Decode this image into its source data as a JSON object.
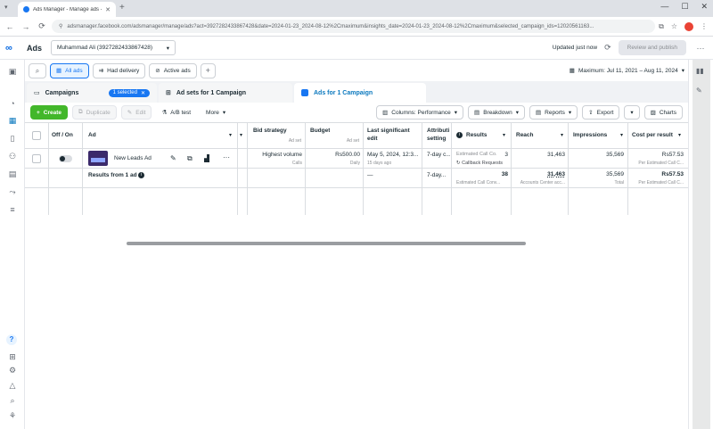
{
  "browser": {
    "tab_title": "Ads Manager - Manage ads - A...",
    "url": "adsmanager.facebook.com/adsmanager/manage/ads?act=3927282433867428&date=2024-01-23_2024-08-12%2Cmaximum&insights_date=2024-01-23_2024-08-12%2Cmaximum&selected_campaign_ids=12020561163...",
    "nav": {
      "back": "←",
      "forward": "→",
      "reload": "C"
    },
    "window_controls": {
      "minimize": "—",
      "maximize": "☐",
      "close": "✕"
    }
  },
  "header": {
    "app_title": "Ads",
    "account_name": "Muhammad Ali (3927282433867428)",
    "updated_text": "Updated just now",
    "review_button": "Review and publish"
  },
  "filters": {
    "all_ads": "All ads",
    "had_delivery": "Had delivery",
    "active_ads": "Active ads",
    "date_range": "Maximum: Jul 11, 2021 – Aug 11, 2024"
  },
  "tabs": {
    "campaigns": "Campaigns",
    "selected_badge": "1 selected",
    "adsets": "Ad sets for 1 Campaign",
    "ads": "Ads for 1 Campaign"
  },
  "toolbar": {
    "create": "Create",
    "duplicate": "Duplicate",
    "edit": "Edit",
    "ab_test": "A/B test",
    "more": "More",
    "columns": "Columns: Performance",
    "breakdown": "Breakdown",
    "reports": "Reports",
    "export": "Export",
    "charts": "Charts"
  },
  "table": {
    "headers": {
      "off_on": "Off / On",
      "ad": "Ad",
      "bid_strategy": "Bid strategy",
      "bid_strategy_sub": "Ad set",
      "budget": "Budget",
      "budget_sub": "Ad set",
      "last_edit_1": "Last significant",
      "last_edit_2": "edit",
      "attribution_1": "Attributi",
      "attribution_2": "setting",
      "results": "Results",
      "reach": "Reach",
      "impressions": "Impressions",
      "cost_per_result": "Cost per result"
    },
    "row": {
      "ad_name": "New Leads Ad",
      "bid_strategy": "Highest volume",
      "bid_strategy_sub": "Calls",
      "budget": "Rs500.00",
      "budget_sub": "Daily",
      "last_edit": "May 5, 2024, 12:3...",
      "last_edit_sub": "15 days ago",
      "attribution": "7-day c...",
      "results_label": "Estimated Call Co...",
      "results_value": "3",
      "results_sub": "Callback Requests",
      "reach": "31,463",
      "impressions": "35,569",
      "cost": "Rs57.53",
      "cost_sub": "Per Estimated Call C..."
    },
    "total": {
      "label": "Results from 1 ad",
      "last_edit": "—",
      "attribution": "7-day...",
      "results_value": "38",
      "results_sub": "Estimated Call Conv...",
      "reach": "31,463",
      "reach_sub": "Accounts Center acc...",
      "impressions": "35,569",
      "impressions_sub": "Total",
      "cost": "Rs57.53",
      "cost_sub": "Per Estimated Call C..."
    }
  }
}
